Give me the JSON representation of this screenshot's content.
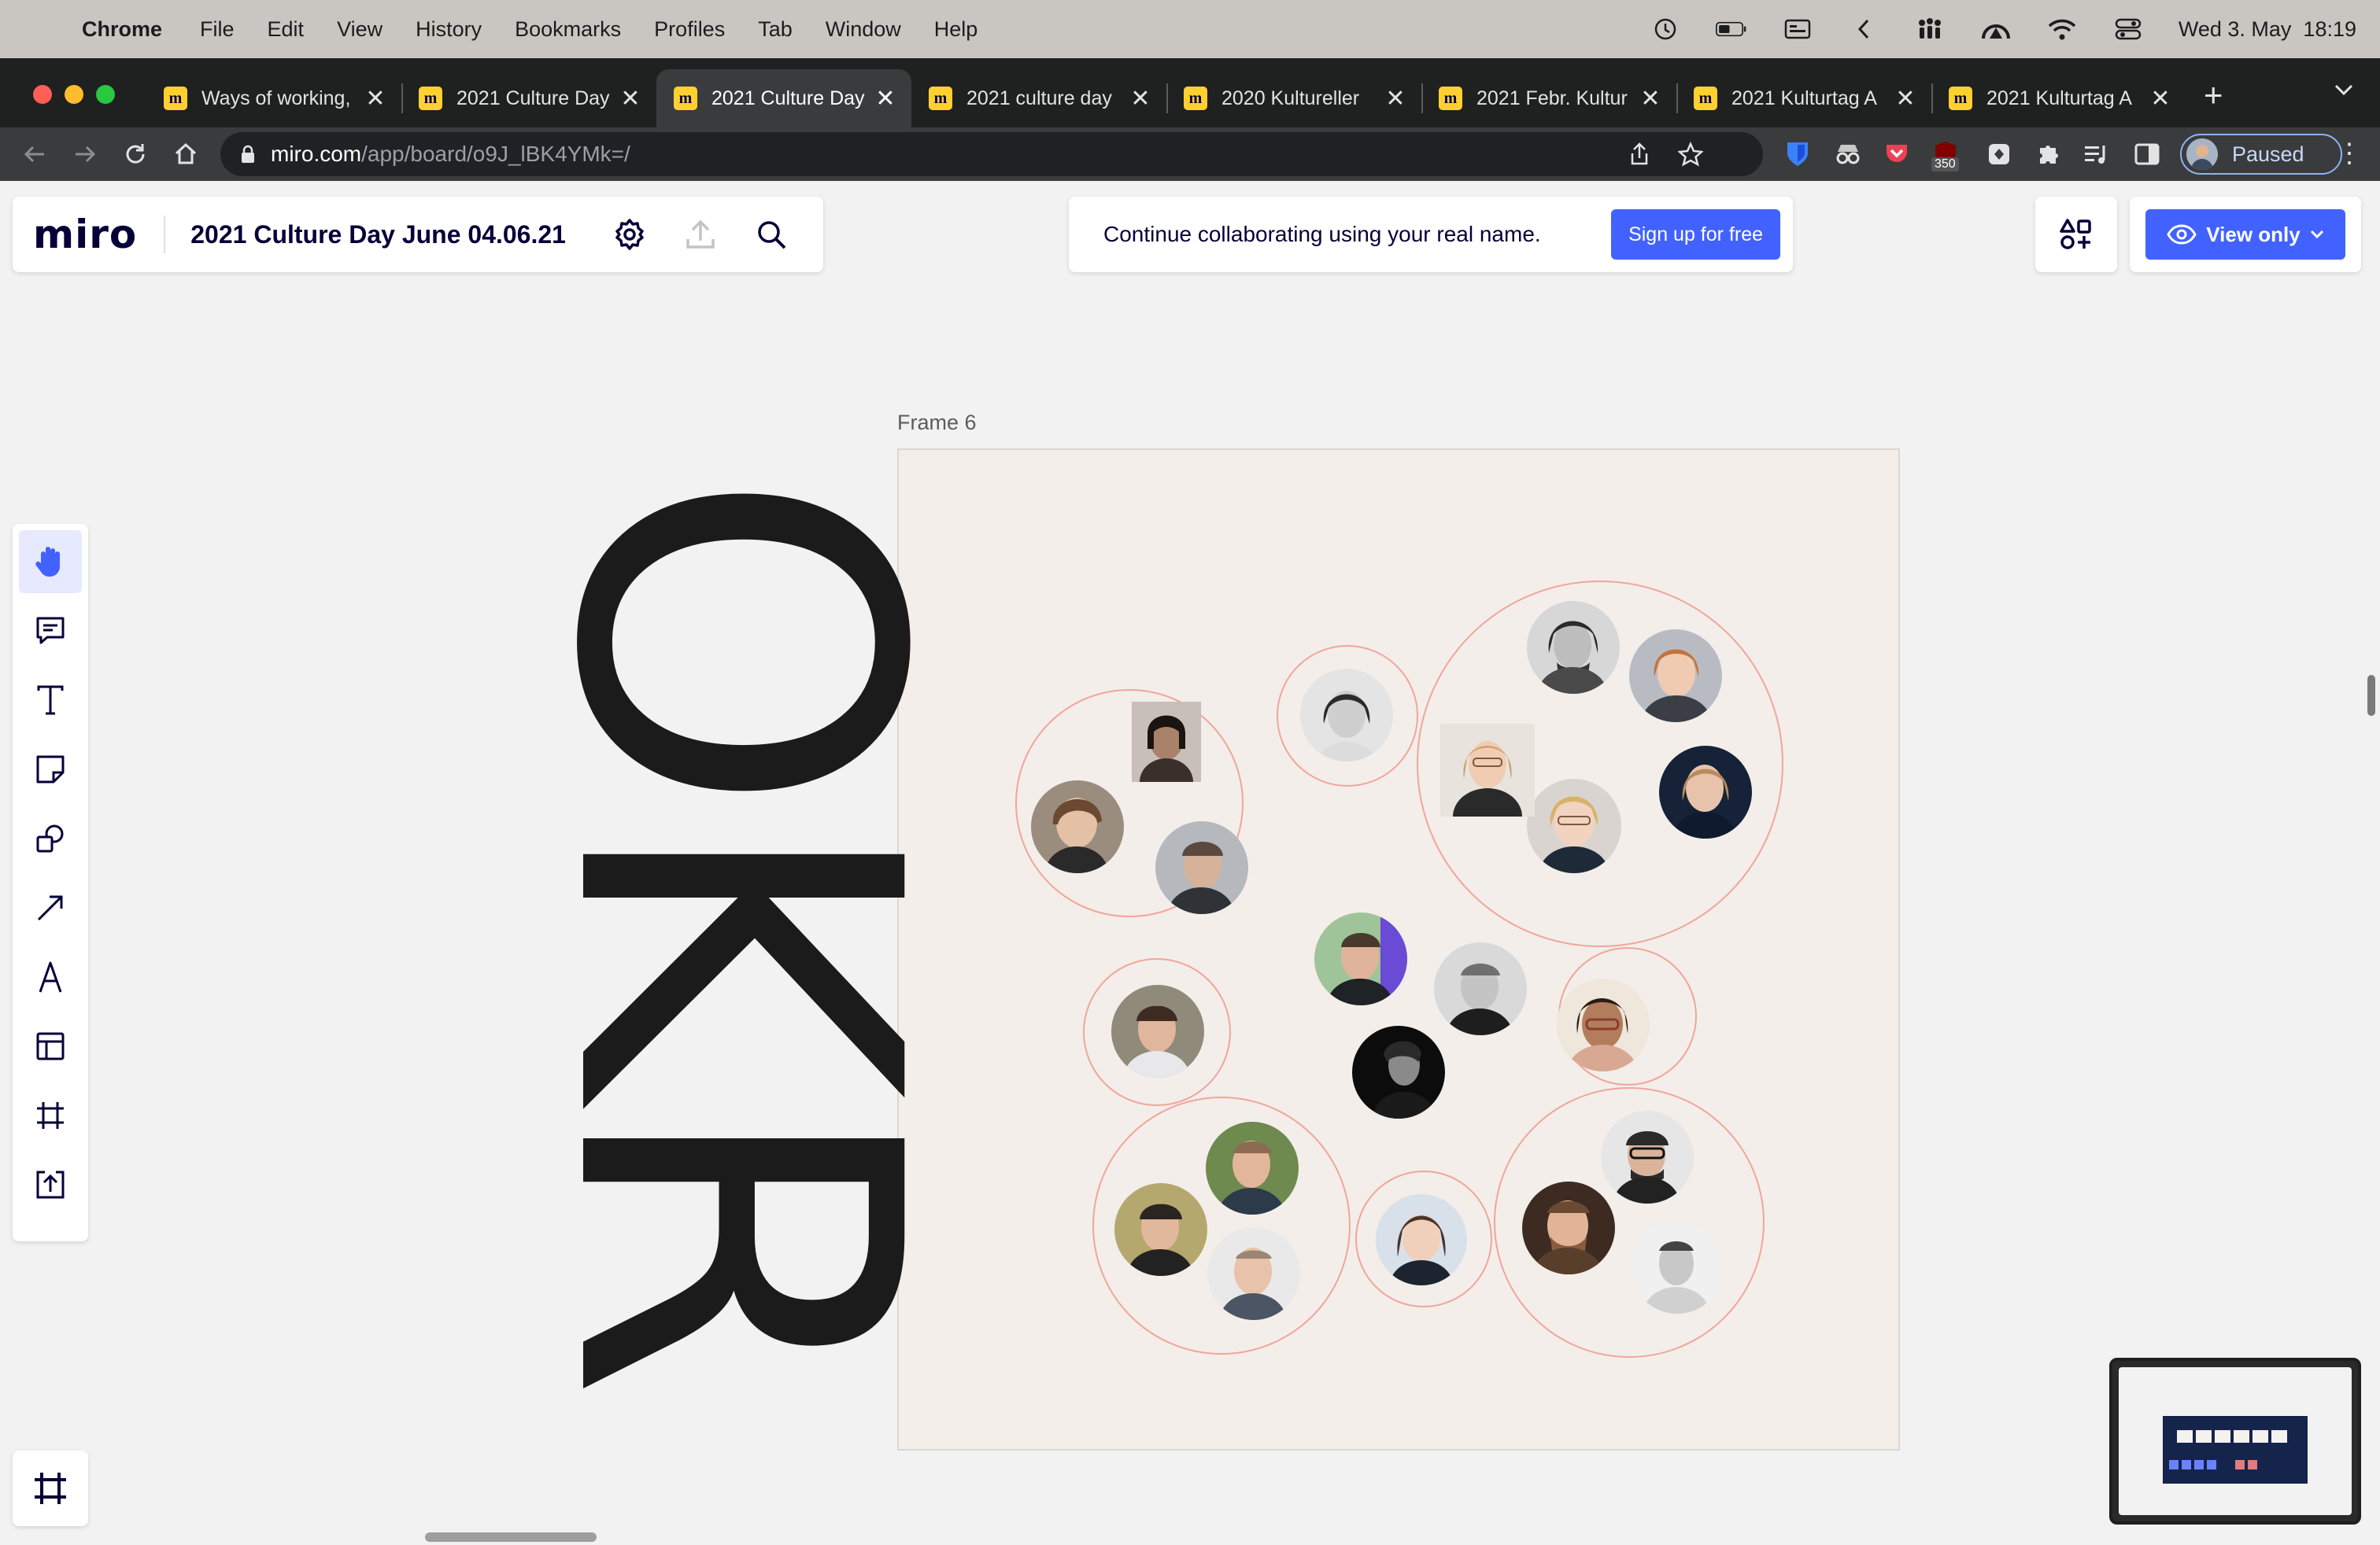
{
  "menubar": {
    "app_name": "Chrome",
    "items": [
      "File",
      "Edit",
      "View",
      "History",
      "Bookmarks",
      "Profiles",
      "Tab",
      "Window",
      "Help"
    ],
    "clock": "Wed 3. May  18:19"
  },
  "tabs": [
    {
      "title": "Ways of working,",
      "active": false
    },
    {
      "title": "2021 Culture Day",
      "active": false
    },
    {
      "title": "2021 Culture Day",
      "active": true
    },
    {
      "title": "2021 culture day",
      "active": false
    },
    {
      "title": "2020 Kultureller",
      "active": false
    },
    {
      "title": "2021 Febr. Kultur",
      "active": false
    },
    {
      "title": "2021 Kulturtag A",
      "active": false
    },
    {
      "title": "2021 Kulturtag A",
      "active": false
    }
  ],
  "tab_close_glyph": "✕",
  "new_tab_glyph": "+",
  "address_bar": {
    "host": "miro.com",
    "path": "/app/board/o9J_lBK4YMk=/"
  },
  "extensions": {
    "badge_count": "350"
  },
  "profile": {
    "status": "Paused"
  },
  "miro": {
    "logo": "miro",
    "board_title": "2021 Culture Day June 04.06.21",
    "banner_text": "Continue collaborating using your real name.",
    "signup_label": "Sign up for free",
    "view_only_label": "View only",
    "frame_label": "Frame 6",
    "big_text": "OKR"
  },
  "colors": {
    "miro_blue": "#4262ff",
    "frame_bg": "#f3eeea",
    "circle_stroke": "#f2a59a",
    "miro_yellow": "#ffd02f"
  }
}
